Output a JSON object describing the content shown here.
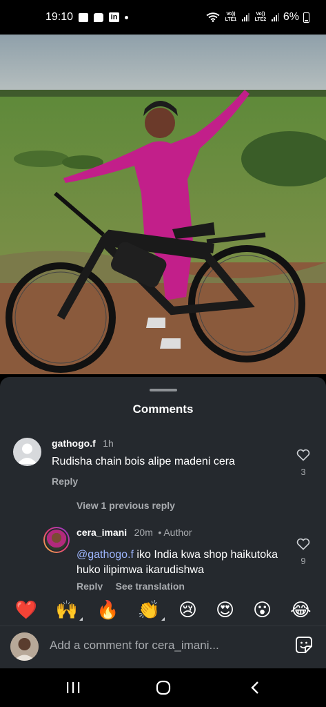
{
  "status_bar": {
    "time": "19:10",
    "net1": "Vo)) LTE1",
    "net2": "Vo)) LTE2",
    "battery": "6%"
  },
  "post": {
    "photo_alt": "",
    "mute_icon": "speaker-muted-icon"
  },
  "comments": {
    "title": "Comments",
    "items": [
      {
        "username": "gathogo.f",
        "time": "1h",
        "text": "Rudisha chain bois alipe madeni cera",
        "reply_label": "Reply",
        "likes": "3"
      },
      {
        "username": "cera_imani",
        "time": "20m",
        "badge": "• Author",
        "mention": "@gathogo.f",
        "text_after_mention": " iko India kwa shop haikutoka huko ilipimwa ikarudishwa",
        "reply_label": "Reply",
        "see_translation": "See translation",
        "likes": "9"
      }
    ],
    "view_previous": "View 1 previous reply"
  },
  "emoji_bar": [
    "❤️",
    "🙌",
    "🔥",
    "👏",
    "😢",
    "😍",
    "😮",
    "😂"
  ],
  "composer": {
    "placeholder": "Add a comment for cera_imani..."
  },
  "colors": {
    "sheet_bg": "#25292e",
    "mention": "#9db6ff",
    "muted_text": "#a8abaf"
  }
}
